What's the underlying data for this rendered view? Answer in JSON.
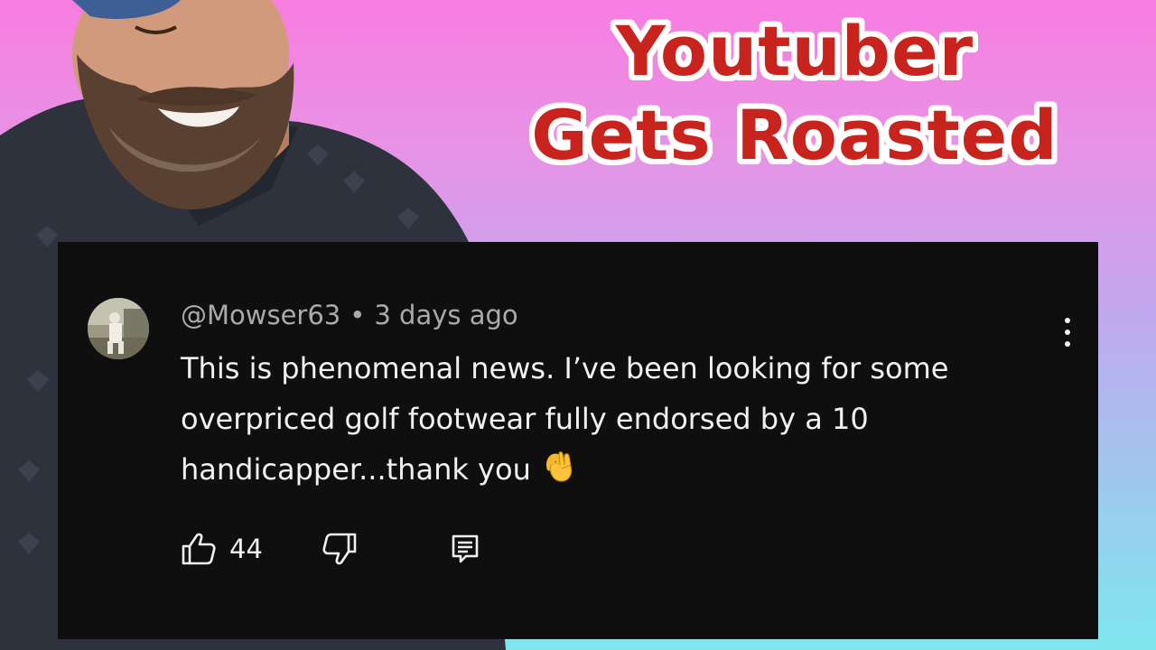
{
  "headline": {
    "line1": "Youtuber",
    "line2": "Gets Roasted",
    "text_color": "#c8231c",
    "outline_color": "#ffffff"
  },
  "background": {
    "gradient_top": "#f77de0",
    "gradient_bottom": "#7fe6ee"
  },
  "person": {
    "description_icon": "laughing-bearded-man-photo"
  },
  "comment": {
    "author": "@Mowser63",
    "separator": "•",
    "timestamp": "3 days ago",
    "text": "This is phenomenal news. I’ve been looking for some overpriced golf footwear fully endorsed by a 10 handicapper...thank you",
    "emoji_icon": "ok-hand-emoji",
    "like_count": "44",
    "like_icon": "thumbs-up-icon",
    "dislike_icon": "thumbs-down-icon",
    "reply_icon": "reply-comment-icon",
    "menu_icon": "more-vert-icon",
    "card_color": "#0f0f0f",
    "text_color": "#f1f1f1",
    "meta_color": "#aaaaaa"
  }
}
